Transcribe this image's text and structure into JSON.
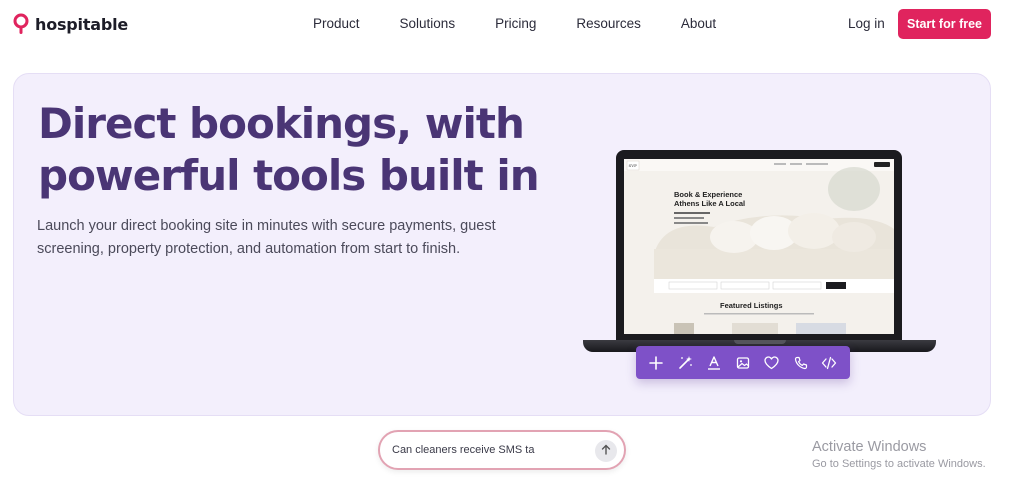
{
  "brand": {
    "name": "hospitable",
    "color": "#e0245e"
  },
  "nav": {
    "links": [
      "Product",
      "Solutions",
      "Pricing",
      "Resources",
      "About"
    ],
    "login": "Log in",
    "cta": "Start for free"
  },
  "hero": {
    "title": "Direct bookings, with powerful tools built in",
    "subtitle": "Launch your direct booking site in minutes with secure payments, guest screening, property protection, and automation from start to finish."
  },
  "preview": {
    "logo": "SVP",
    "headline": "Book & Experience Athens Like A Local",
    "tagline": "The Best Short-term Rentals for Your Next Classic City adventure",
    "search_button": "Search",
    "section_title": "Featured Listings"
  },
  "toolbar": {
    "icons": [
      "plus-icon",
      "magic-wand-icon",
      "text-icon",
      "image-icon",
      "heart-icon",
      "phone-icon",
      "code-icon"
    ],
    "color": "#7e51c8"
  },
  "chat": {
    "value": "Can cleaners receive SMS ta"
  },
  "watermark": {
    "title": "Activate Windows",
    "subtitle": "Go to Settings to activate Windows."
  }
}
